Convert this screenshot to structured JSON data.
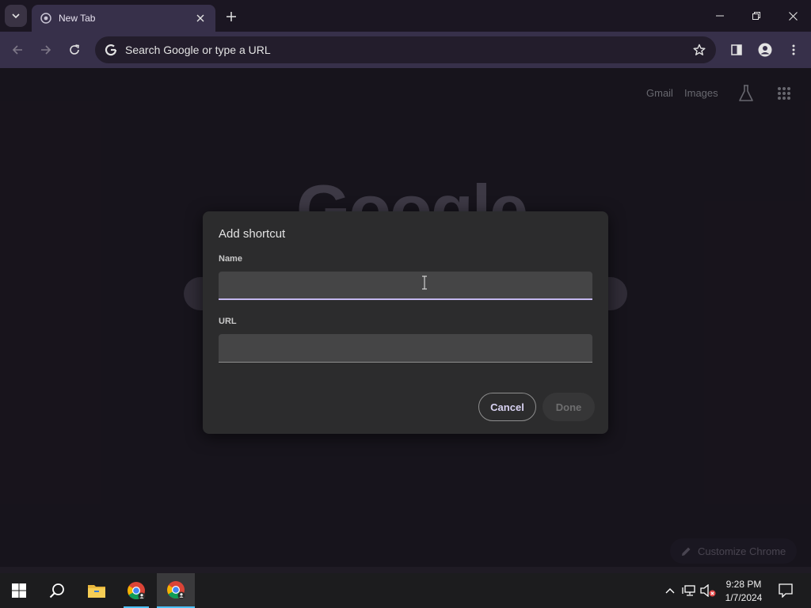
{
  "browser": {
    "tab": {
      "title": "New Tab"
    },
    "omnibox": {
      "placeholder": "Search Google or type a URL"
    }
  },
  "ntp": {
    "links": {
      "gmail": "Gmail",
      "images": "Images"
    },
    "logo": "Google",
    "customize_label": "Customize Chrome"
  },
  "dialog": {
    "title": "Add shortcut",
    "name_label": "Name",
    "name_value": "",
    "url_label": "URL",
    "url_value": "",
    "cancel_label": "Cancel",
    "done_label": "Done"
  },
  "taskbar": {
    "time": "9:28 PM",
    "date": "1/7/2024"
  },
  "colors": {
    "accent": "#c4b8f0",
    "taskbar_active": "#4cc2ff"
  }
}
